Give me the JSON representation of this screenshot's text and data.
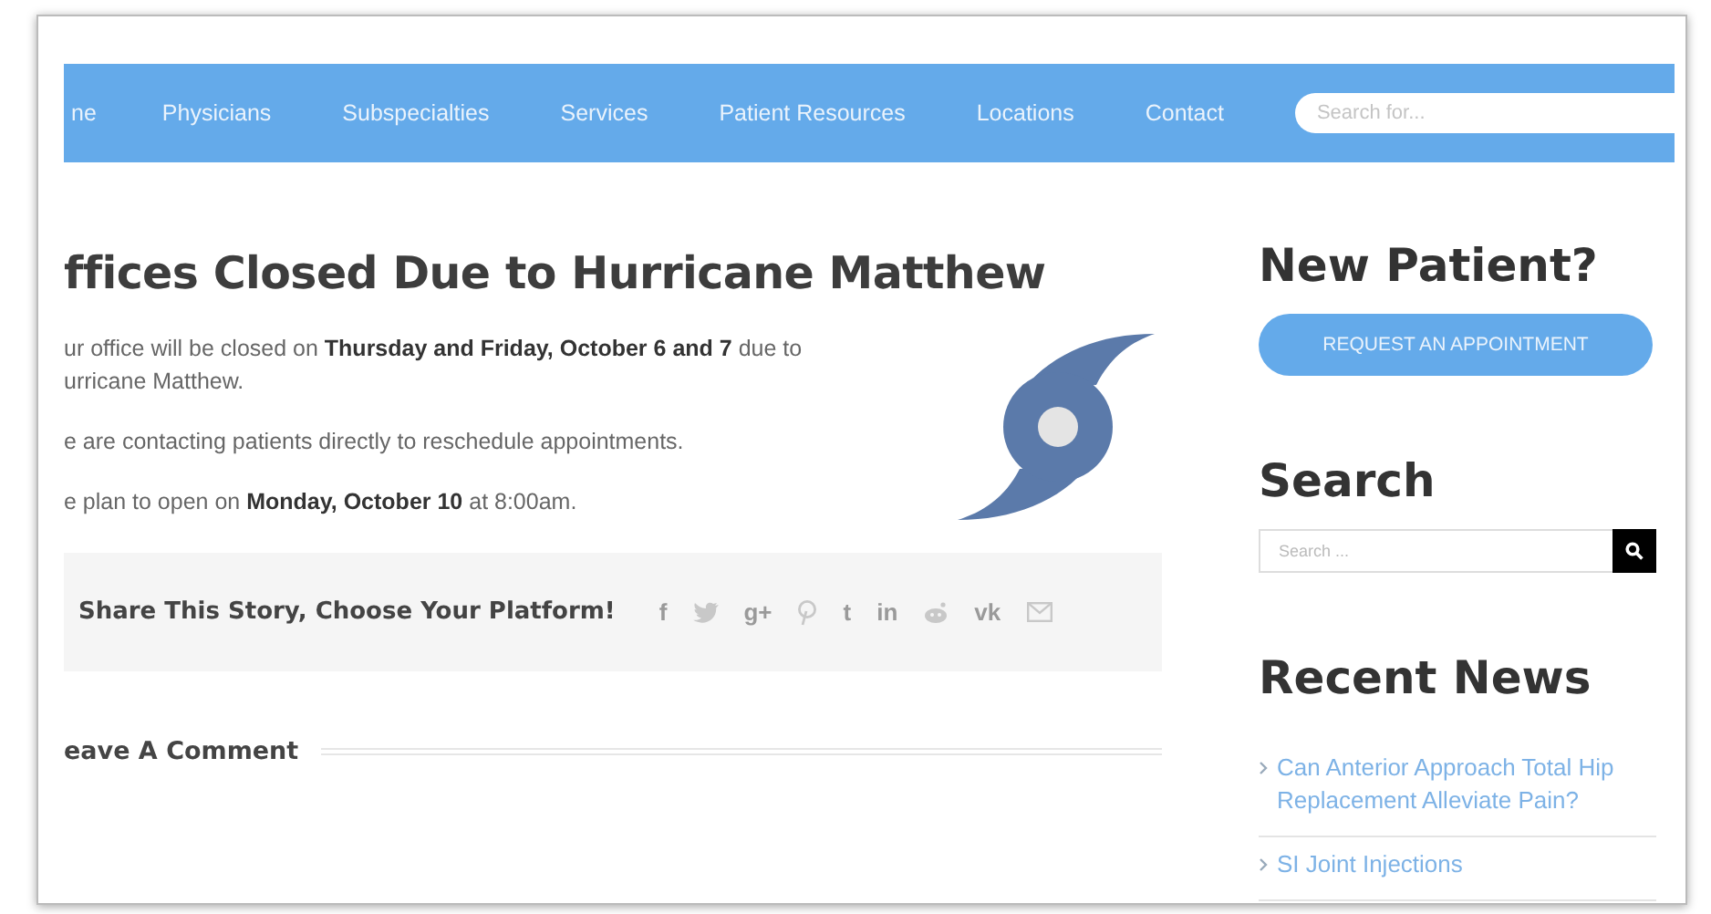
{
  "nav": {
    "items": [
      {
        "label": "ne"
      },
      {
        "label": "Physicians"
      },
      {
        "label": "Subspecialties"
      },
      {
        "label": "Services"
      },
      {
        "label": "Patient Resources"
      },
      {
        "label": "Locations"
      },
      {
        "label": "Contact"
      }
    ],
    "search": {
      "placeholder": "Search for..."
    }
  },
  "post": {
    "title": "ffices Closed Due to Hurricane Matthew",
    "paragraphs": [
      "ur office will be closed on **Thursday and Friday, October 6 and 7** due to urricane Matthew.",
      "e are contacting patients directly to reschedule appointments.",
      "e plan to open on **Monday, October 10** at 8:00am."
    ],
    "share": {
      "label": "Share This Story, Choose Your Platform!",
      "icons": [
        {
          "kind": "text",
          "text": "f"
        },
        {
          "kind": "bird"
        },
        {
          "kind": "text",
          "text": "g+"
        },
        {
          "kind": "pin"
        },
        {
          "kind": "text",
          "text": "t"
        },
        {
          "kind": "text",
          "text": "in"
        },
        {
          "kind": "alien"
        },
        {
          "kind": "text",
          "text": "vk"
        },
        {
          "kind": "mail"
        }
      ]
    },
    "comment_heading": "eave A Comment"
  },
  "sidebar": {
    "new_patient": {
      "heading": "New Patient?",
      "button": "REQUEST AN APPOINTMENT"
    },
    "search": {
      "heading": "Search",
      "placeholder": "Search ..."
    },
    "recent": {
      "heading": "Recent News",
      "items": [
        {
          "title": "Can Anterior Approach Total Hip Replacement Alleviate Pain?"
        },
        {
          "title": "SI Joint Injections"
        }
      ]
    }
  }
}
